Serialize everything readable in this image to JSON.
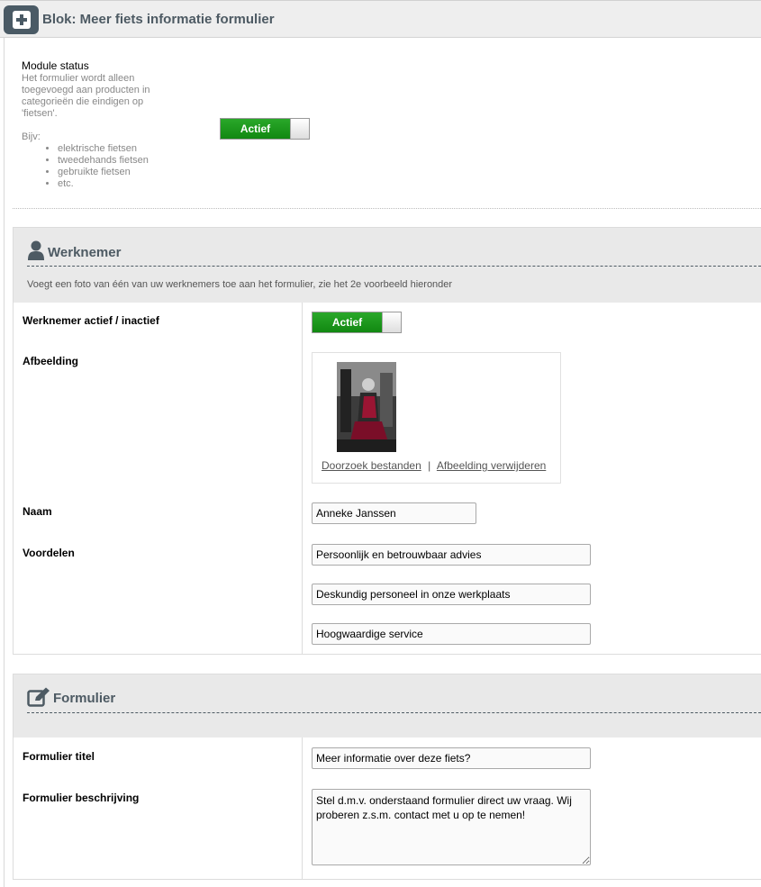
{
  "header": {
    "title": "Blok: Meer fiets informatie formulier"
  },
  "module_status": {
    "title": "Module status",
    "description": "Het formulier wordt alleen toegevoegd aan producten in categorieën die eindigen op 'fietsen'.",
    "bijv": "Bijv:",
    "examples": [
      "elektrische fietsen",
      "tweedehands fietsen",
      "gebruikte fietsen",
      "etc."
    ],
    "toggle_label": "Actief"
  },
  "werknemer": {
    "title": "Werknemer",
    "description": "Voegt een foto van één van uw werknemers toe aan het formulier, zie het 2e voorbeeld hieronder",
    "active_label": "Werknemer actief / inactief",
    "active_toggle": "Actief",
    "image_label": "Afbeelding",
    "browse_link": "Doorzoek bestanden",
    "separator": "|",
    "remove_link": "Afbeelding verwijderen",
    "name_label": "Naam",
    "name_value": "Anneke Janssen",
    "benefits_label": "Voordelen",
    "benefits": [
      "Persoonlijk en betrouwbaar advies",
      "Deskundig personeel in onze werkplaats",
      "Hoogwaardige service"
    ]
  },
  "formulier": {
    "title": "Formulier",
    "title_label": "Formulier titel",
    "title_value": "Meer informatie over deze fiets?",
    "desc_label": "Formulier beschrijving",
    "desc_value": "Stel d.m.v. onderstaand formulier direct uw vraag. Wij proberen z.s.m. contact met u op te nemen!"
  },
  "colors": {
    "accent": "#4d5a63",
    "toggle_green": "#1a961a",
    "panel_bg": "#e9e9e9"
  }
}
